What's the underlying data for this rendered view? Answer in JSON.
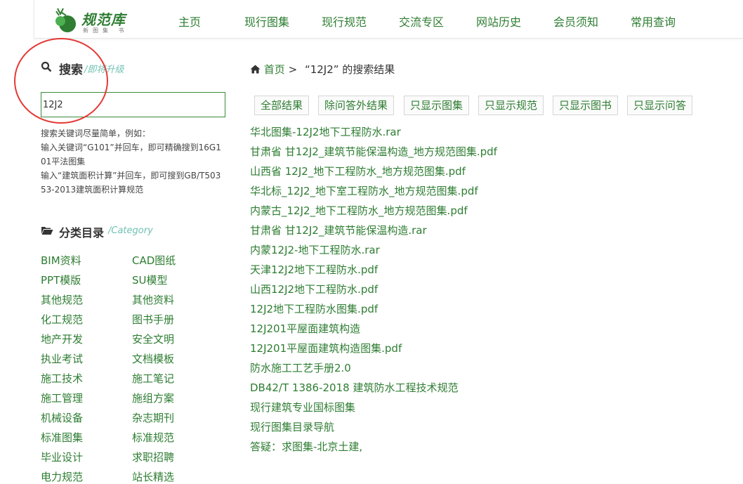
{
  "header": {
    "logo": {
      "title": "规范库",
      "subtitle": "新图集 书"
    },
    "nav": [
      "主页",
      "现行图集",
      "现行规范",
      "交流专区",
      "网站历史",
      "会员须知",
      "常用查询"
    ]
  },
  "sidebar": {
    "search": {
      "title": "搜索",
      "subtitle": "/即将升级",
      "value": "12J2",
      "hint_lines": [
        "搜索关键词尽量简单，例如：",
        "输入关键词“G101”并回车，即可精确搜到16G101平法图集",
        "输入“建筑面积计算”并回车，即可搜到GB/T50353-2013建筑面积计算规范"
      ]
    },
    "category": {
      "title": "分类目录",
      "subtitle": "/Category",
      "items": [
        "BIM资料",
        "CAD图纸",
        "PPT模版",
        "SU模型",
        "其他规范",
        "其他资料",
        "化工规范",
        "图书手册",
        "地产开发",
        "安全文明",
        "执业考试",
        "文档模板",
        "施工技术",
        "施工笔记",
        "施工管理",
        "施组方案",
        "机械设备",
        "杂志期刊",
        "标准图集",
        "标准规范",
        "毕业设计",
        "求职招聘",
        "电力规范",
        "站长精选"
      ]
    }
  },
  "main": {
    "breadcrumb": {
      "home": "首页",
      "separator": ">",
      "query_text": "“12J2” 的搜索结果"
    },
    "filters": [
      "全部结果",
      "除问答外结果",
      "只显示图集",
      "只显示规范",
      "只显示图书",
      "只显示问答"
    ],
    "results": [
      "华北图集-12J2地下工程防水.rar",
      "甘肃省 甘12J2_建筑节能保温构造_地方规范图集.pdf",
      "山西省 12J2_地下工程防水_地方规范图集.pdf",
      "华北标_12J2_地下室工程防水_地方规范图集.pdf",
      "内蒙古_12J2_地下工程防水_地方规范图集.pdf",
      "甘肃省 甘12J2_建筑节能保温构造.rar",
      "内蒙12J2-地下工程防水.rar",
      "天津12J2地下工程防水.pdf",
      "山西12J2地下工程防水.pdf",
      "12J2地下工程防水图集.pdf",
      "12J201平屋面建筑构造",
      "12J201平屋面建筑构造图集.pdf",
      "防水施工工艺手册2.0",
      "DB42/T 1386-2018 建筑防水工程技术规范",
      "现行建筑专业国标图集",
      "现行图集目录导航",
      "答疑：求图集-北京土建,"
    ]
  },
  "colors": {
    "link": "#2e7d32",
    "accent": "#6fc2b3",
    "annotation": "#e53935"
  }
}
